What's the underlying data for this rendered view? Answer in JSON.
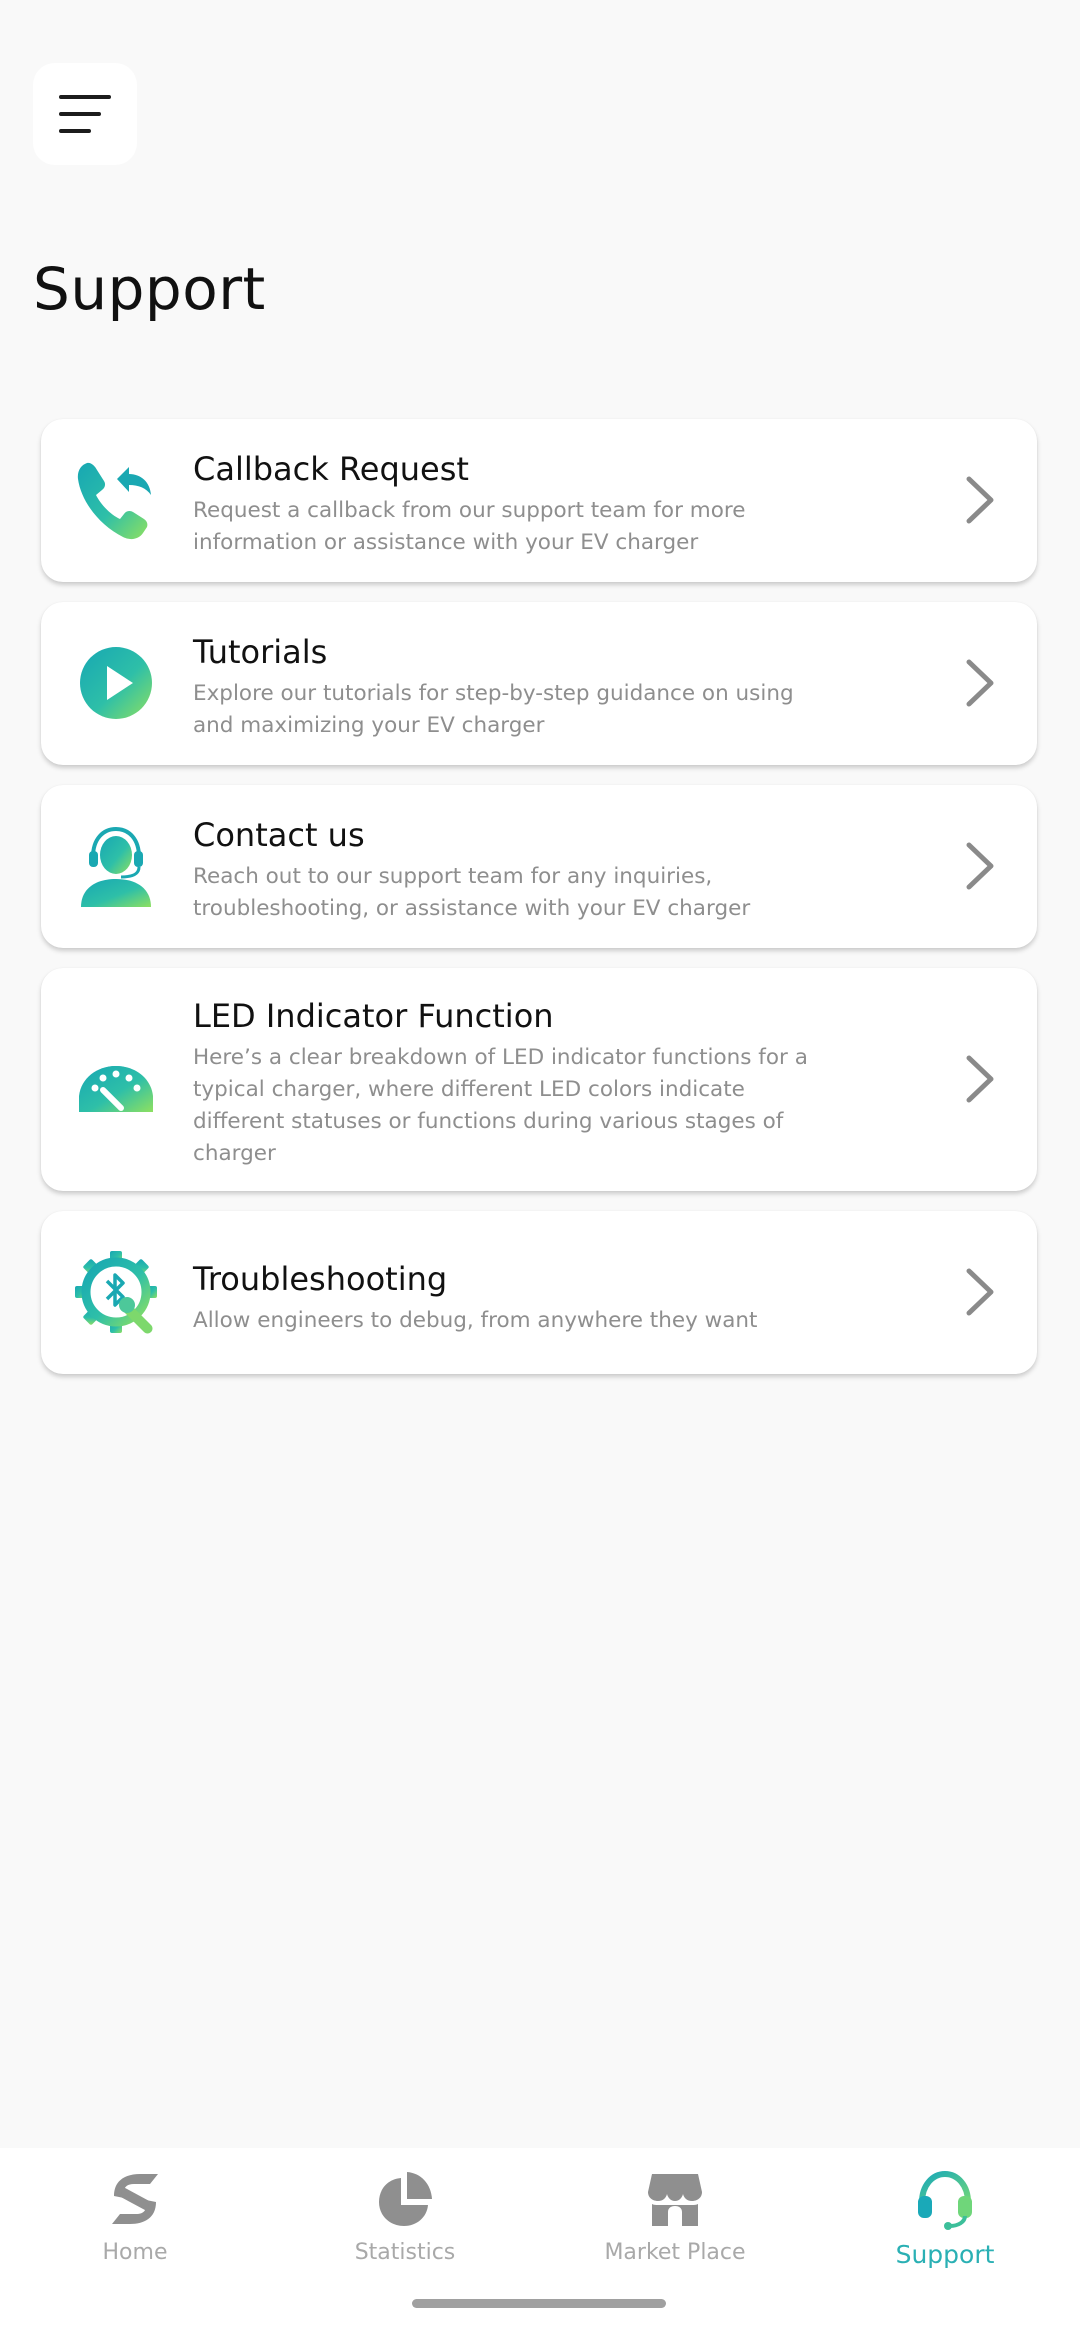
{
  "page": {
    "title": "Support"
  },
  "colors": {
    "accent": "#2ab0b4",
    "gradient_start": "#17a7b3",
    "gradient_end": "#8ee060",
    "inactive": "#a9a9a9"
  },
  "items": [
    {
      "title": "Callback Request",
      "description": "Request a callback from our support team for more information or assistance with your EV charger",
      "icon": "phone-callback-icon"
    },
    {
      "title": "Tutorials",
      "description": "Explore our tutorials for step-by-step guidance on using and maximizing your EV charger",
      "icon": "play-icon"
    },
    {
      "title": "Contact us",
      "description": "Reach out to our support team for any inquiries, troubleshooting, or assistance with your EV charger",
      "icon": "headset-agent-icon"
    },
    {
      "title": "LED Indicator Function",
      "description": "Here’s a clear breakdown of LED indicator functions for a typical charger, where different LED colors indicate different statuses or functions during various stages of charger",
      "icon": "gauge-icon"
    },
    {
      "title": "Troubleshooting",
      "description": "Allow engineers to debug, from anywhere they want",
      "icon": "gear-bluetooth-wrench-icon"
    }
  ],
  "nav": {
    "items": [
      {
        "label": "Home",
        "icon": "home-sync-icon",
        "active": false
      },
      {
        "label": "Statistics",
        "icon": "pie-chart-icon",
        "active": false
      },
      {
        "label": "Market Place",
        "icon": "store-icon",
        "active": false
      },
      {
        "label": "Support",
        "icon": "headset-icon",
        "active": true
      }
    ]
  }
}
